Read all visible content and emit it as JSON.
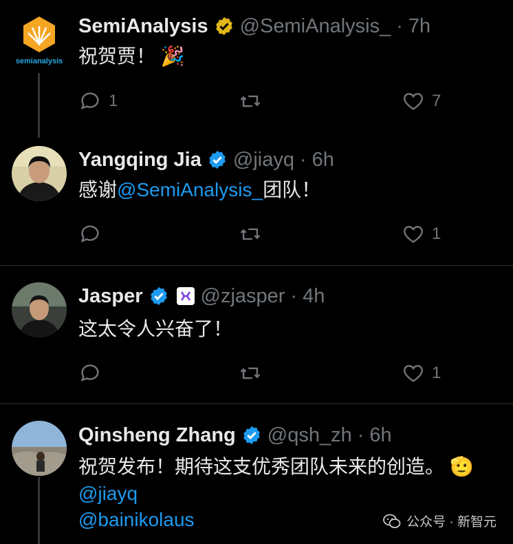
{
  "tweets": [
    {
      "name": "SemiAnalysis",
      "handle": "@SemiAnalysis_",
      "time": "7h",
      "text_before": "祝贺贾！",
      "emoji": "🎉",
      "avatar_logo": "semianalysis",
      "badge": "gold-verified-icon",
      "replies": "1",
      "retweets": "",
      "likes": "7"
    },
    {
      "name": "Yangqing Jia",
      "handle": "@jiayq",
      "time": "6h",
      "text_before": "感谢",
      "mention": "@SemiAnalysis_",
      "text_after": "团队！",
      "badge": "blue-verified-icon",
      "replies": "",
      "retweets": "",
      "likes": "1"
    },
    {
      "name": "Jasper",
      "handle": "@zjasper",
      "time": "4h",
      "text_before": "这太令人兴奋了！",
      "badge": "blue-verified-icon",
      "replies": "",
      "retweets": "",
      "likes": "1"
    },
    {
      "name": "Qinsheng Zhang",
      "handle": "@qsh_zh",
      "time": "6h",
      "text_before": "祝贺发布！期待这支优秀团队未来的创造。",
      "emoji": "🫡",
      "mention1": "@jiayq",
      "mention2": "@bainikolaus",
      "badge": "blue-verified-icon"
    }
  ],
  "separator": "·",
  "watermark": {
    "account": "公众号 · 新智元"
  },
  "colors": {
    "link": "#1d9bf0",
    "muted": "#71767b",
    "gold": "#e2b719",
    "verified": "#1d9bf0"
  }
}
